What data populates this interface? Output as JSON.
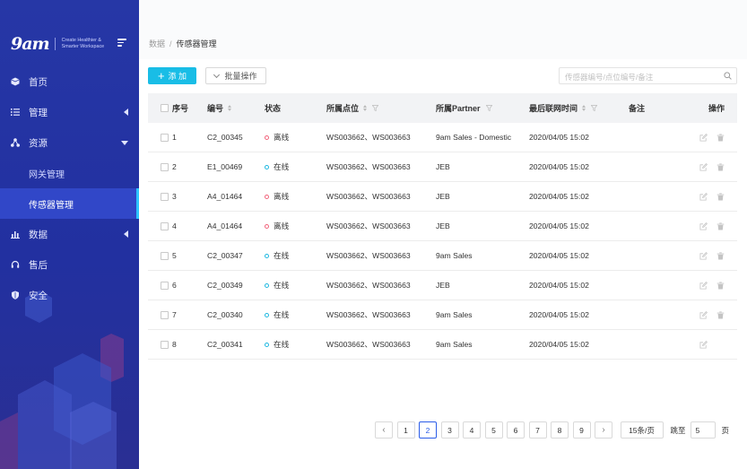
{
  "brand": {
    "logo": "9am",
    "tagline": [
      "Create Healthier &",
      "Smarter Workspace"
    ]
  },
  "menu": [
    {
      "label": "首页",
      "icon": "cube-icon",
      "arrow": ""
    },
    {
      "label": "管理",
      "icon": "list-icon",
      "arrow": "left"
    },
    {
      "label": "资源",
      "icon": "nodes-icon",
      "arrow": "down"
    },
    {
      "label": "网关管理",
      "sub": true
    },
    {
      "label": "传感器管理",
      "sub": true,
      "active": true
    },
    {
      "label": "数据",
      "icon": "bar-chart-icon",
      "arrow": "left"
    },
    {
      "label": "售后",
      "icon": "headset-icon",
      "arrow": ""
    },
    {
      "label": "安全",
      "icon": "shield-icon",
      "arrow": ""
    }
  ],
  "breadcrumb": {
    "parent": "数据",
    "separator": "/",
    "current": "传感器管理"
  },
  "toolbar": {
    "add_label": "添 加",
    "bulk_label": "批量操作",
    "search_placeholder": "传感器编号/点位编号/备注"
  },
  "table": {
    "headers": {
      "no": "序号",
      "code": "编号",
      "status": "状态",
      "point": "所属点位",
      "partner": "所属Partner",
      "time": "最后联网时间",
      "note": "备注",
      "ops": "操作"
    },
    "rows": [
      {
        "no": "1",
        "code": "C2_00345",
        "status": "离线",
        "online": false,
        "point": "WS003662、WS003663",
        "partner": "9am Sales - Domestic",
        "time": "2020/04/05 15:02",
        "note": "",
        "delete": true
      },
      {
        "no": "2",
        "code": "E1_00469",
        "status": "在线",
        "online": true,
        "point": "WS003662、WS003663",
        "partner": "JEB",
        "time": "2020/04/05 15:02",
        "note": "",
        "delete": true
      },
      {
        "no": "3",
        "code": "A4_01464",
        "status": "离线",
        "online": false,
        "point": "WS003662、WS003663",
        "partner": "JEB",
        "time": "2020/04/05 15:02",
        "note": "",
        "delete": true
      },
      {
        "no": "4",
        "code": "A4_01464",
        "status": "离线",
        "online": false,
        "point": "WS003662、WS003663",
        "partner": "JEB",
        "time": "2020/04/05 15:02",
        "note": "",
        "delete": true
      },
      {
        "no": "5",
        "code": "C2_00347",
        "status": "在线",
        "online": true,
        "point": "WS003662、WS003663",
        "partner": "9am Sales",
        "time": "2020/04/05 15:02",
        "note": "",
        "delete": true
      },
      {
        "no": "6",
        "code": "C2_00349",
        "status": "在线",
        "online": true,
        "point": "WS003662、WS003663",
        "partner": "JEB",
        "time": "2020/04/05 15:02",
        "note": "",
        "delete": true
      },
      {
        "no": "7",
        "code": "C2_00340",
        "status": "在线",
        "online": true,
        "point": "WS003662、WS003663",
        "partner": "9am Sales",
        "time": "2020/04/05 15:02",
        "note": "",
        "delete": true
      },
      {
        "no": "8",
        "code": "C2_00341",
        "status": "在线",
        "online": true,
        "point": "WS003662、WS003663",
        "partner": "9am Sales",
        "time": "2020/04/05 15:02",
        "note": "",
        "delete": false
      }
    ]
  },
  "pagination": {
    "pages": [
      "1",
      "2",
      "3",
      "4",
      "5",
      "6",
      "7",
      "8",
      "9"
    ],
    "current": "2",
    "page_size": "15条/页",
    "jump_label": "跳至",
    "jump_value": "5",
    "page_unit": "页",
    "prev": "‹",
    "next": "›"
  },
  "colors": {
    "accent": "#19bde6",
    "sidebar": "#2637a6",
    "offline": "#f2637b",
    "online": "#1fb8e0",
    "active_page": "#2b5ce8"
  }
}
